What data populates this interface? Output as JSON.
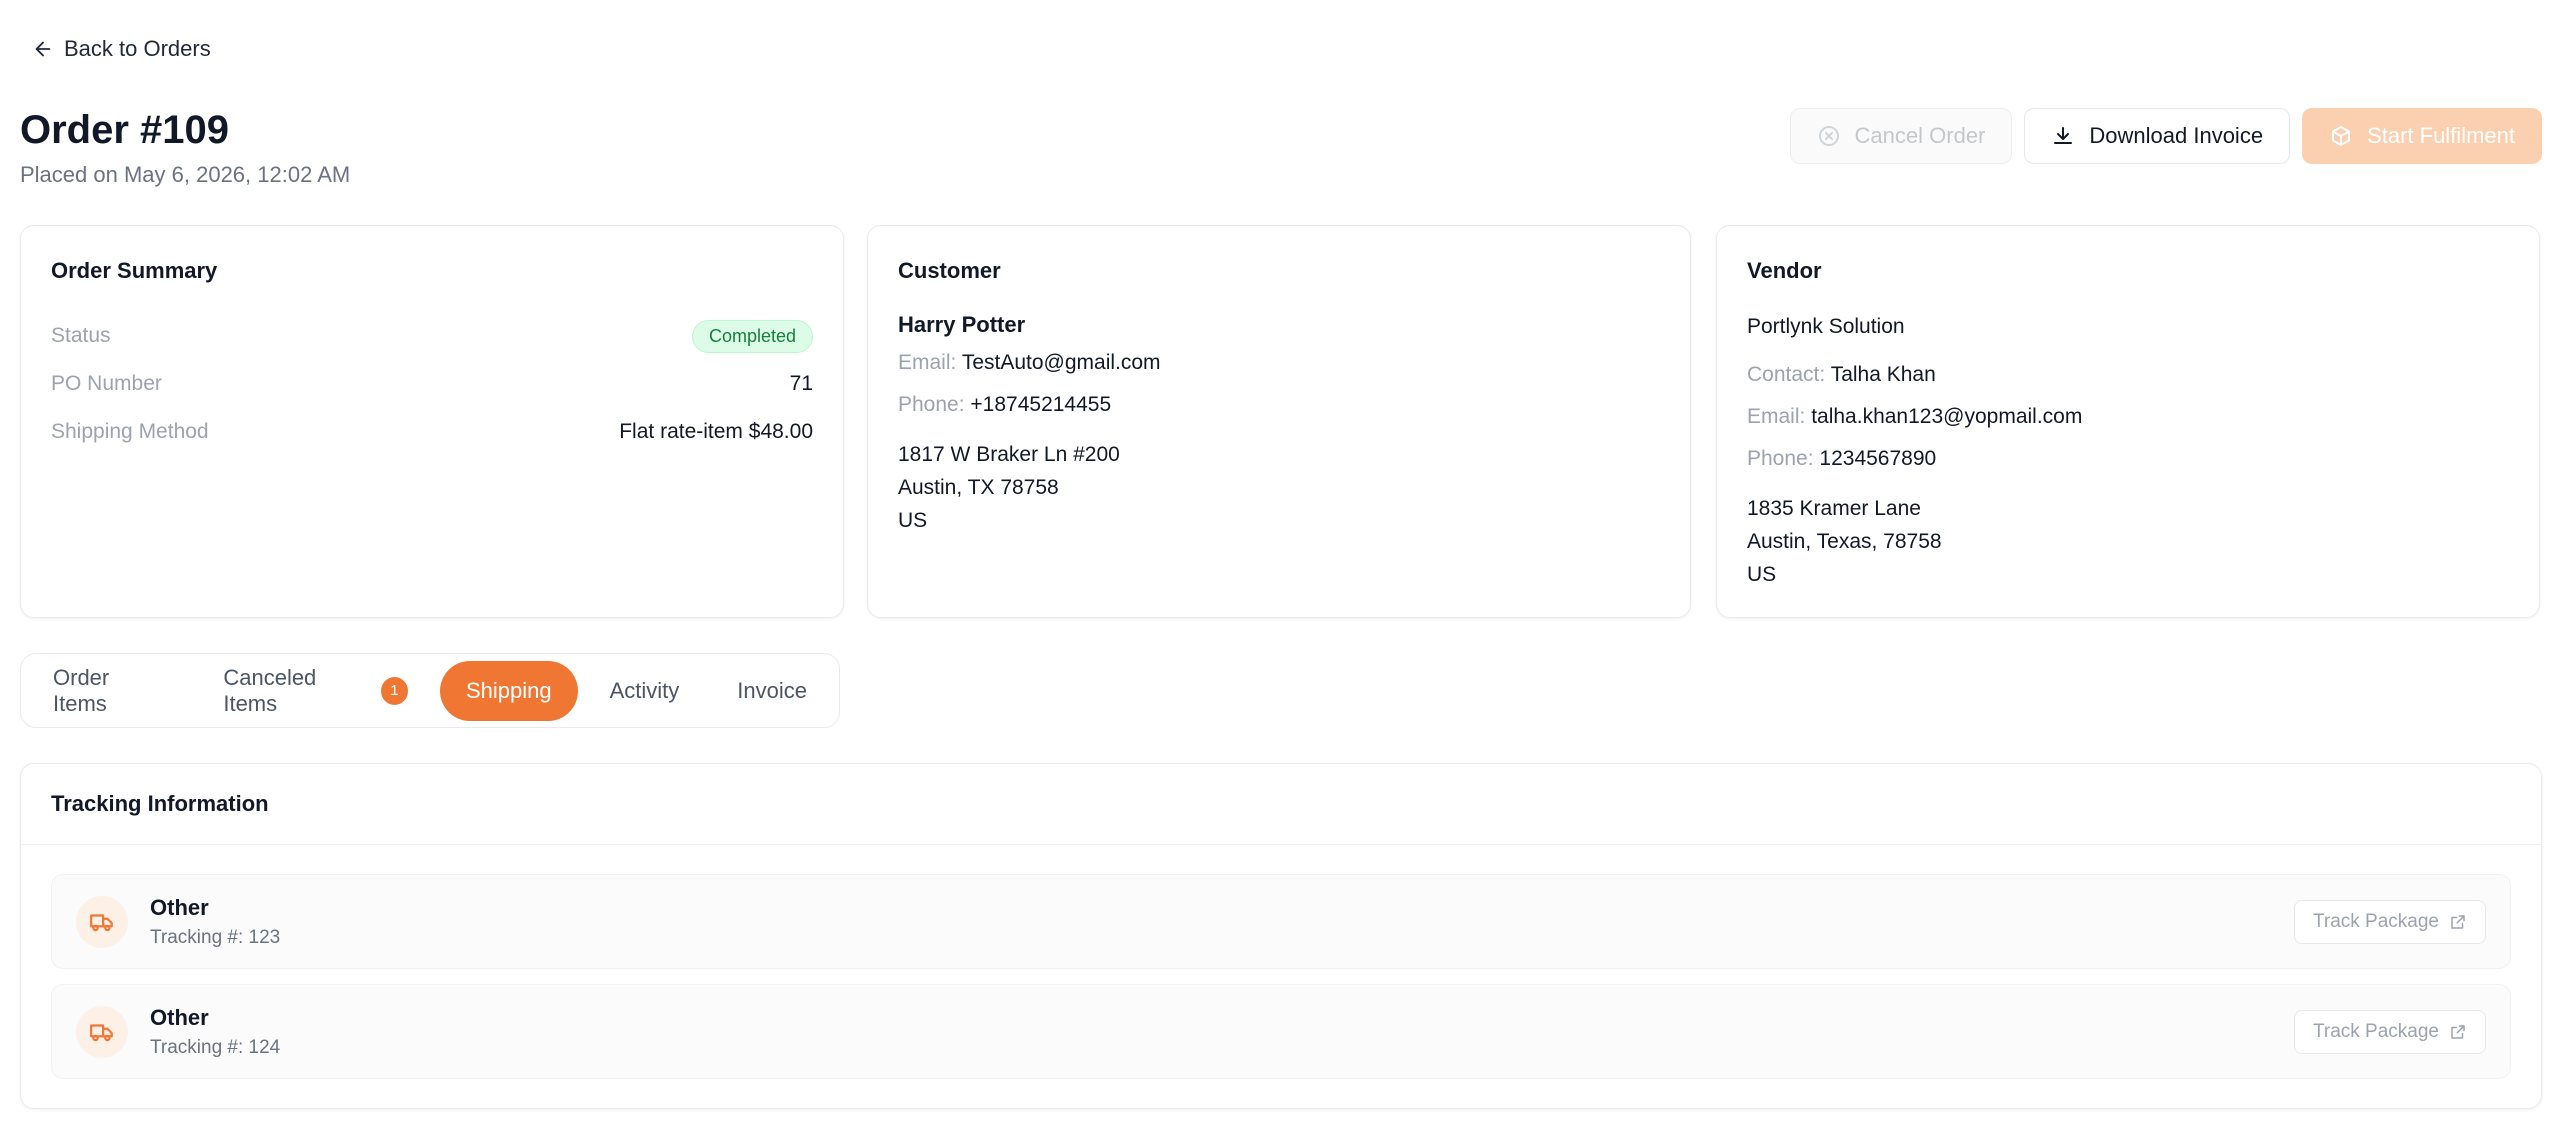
{
  "nav": {
    "back_label": "Back to Orders"
  },
  "header": {
    "title": "Order #109",
    "placed": "Placed on May 6, 2026, 12:02 AM",
    "actions": {
      "cancel": "Cancel Order",
      "download": "Download Invoice",
      "fulfil": "Start Fulfilment"
    }
  },
  "summary": {
    "title": "Order Summary",
    "status_label": "Status",
    "status_value": "Completed",
    "po_label": "PO Number",
    "po_value": "71",
    "shipping_label": "Shipping Method",
    "shipping_value": "Flat rate-item $48.00"
  },
  "customer": {
    "title": "Customer",
    "name": "Harry Potter",
    "email_label": "Email:",
    "email": "TestAuto@gmail.com",
    "phone_label": "Phone:",
    "phone": "+18745214455",
    "address": [
      "1817 W Braker Ln #200",
      "Austin, TX 78758",
      "US"
    ]
  },
  "vendor": {
    "title": "Vendor",
    "name": "Portlynk Solution",
    "contact_label": "Contact:",
    "contact": "Talha Khan",
    "email_label": "Email:",
    "email": "talha.khan123@yopmail.com",
    "phone_label": "Phone:",
    "phone": "1234567890",
    "address": [
      "1835 Kramer Lane",
      "Austin, Texas, 78758",
      "US"
    ]
  },
  "tabs": [
    {
      "label": "Order Items"
    },
    {
      "label": "Canceled Items",
      "count": "1"
    },
    {
      "label": "Shipping"
    },
    {
      "label": "Activity"
    },
    {
      "label": "Invoice"
    }
  ],
  "tracking": {
    "title": "Tracking Information",
    "track_label": "Track Package",
    "packages": [
      {
        "carrier": "Other",
        "tracking": "Tracking #: 123"
      },
      {
        "carrier": "Other",
        "tracking": "Tracking #: 124"
      }
    ]
  },
  "colors": {
    "accent": "#f07633",
    "success_bg": "#dcfce7",
    "success_text": "#15803d"
  }
}
